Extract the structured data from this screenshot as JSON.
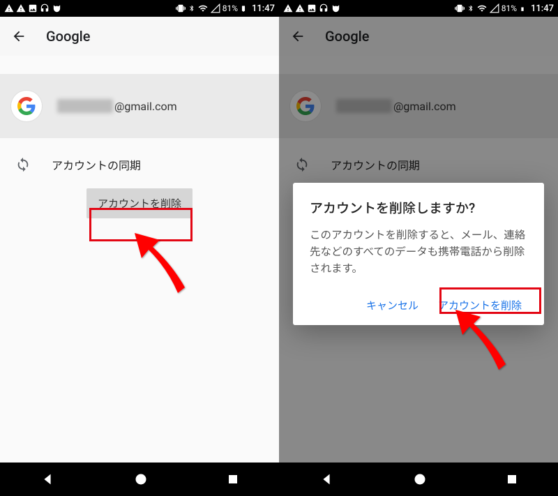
{
  "status": {
    "battery": "81%",
    "time": "11:47"
  },
  "appbar": {
    "title": "Google"
  },
  "account": {
    "email_suffix": "@gmail.com"
  },
  "sync": {
    "label": "アカウントの同期"
  },
  "delete_button": {
    "label": "アカウントを削除"
  },
  "dialog": {
    "title": "アカウントを削除しますか?",
    "body": "このアカウントを削除すると、メール、連絡先などのすべてのデータも携帯電話から削除されます。",
    "cancel": "キャンセル",
    "confirm": "アカウントを削除"
  }
}
